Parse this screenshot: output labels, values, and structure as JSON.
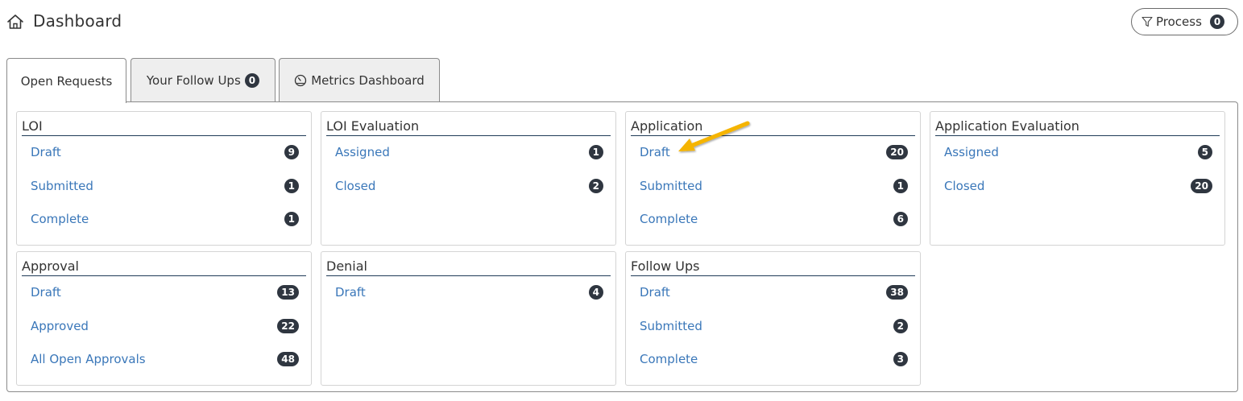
{
  "header": {
    "title": "Dashboard",
    "home_icon": "home-icon",
    "process_label": "Process",
    "process_count": "0"
  },
  "tabs": [
    {
      "label": "Open Requests",
      "active": true
    },
    {
      "label": "Your Follow Ups",
      "count": "0"
    },
    {
      "label": "Metrics Dashboard",
      "icon": "gauge-icon"
    }
  ],
  "cards": {
    "loi": {
      "title": "LOI",
      "rows": [
        {
          "label": "Draft",
          "count": "9"
        },
        {
          "label": "Submitted",
          "count": "1"
        },
        {
          "label": "Complete",
          "count": "1"
        }
      ]
    },
    "loi_evaluation": {
      "title": "LOI Evaluation",
      "rows": [
        {
          "label": "Assigned",
          "count": "1"
        },
        {
          "label": "Closed",
          "count": "2"
        }
      ]
    },
    "application": {
      "title": "Application",
      "rows": [
        {
          "label": "Draft",
          "count": "20"
        },
        {
          "label": "Submitted",
          "count": "1"
        },
        {
          "label": "Complete",
          "count": "6"
        }
      ]
    },
    "application_evaluation": {
      "title": "Application Evaluation",
      "rows": [
        {
          "label": "Assigned",
          "count": "5"
        },
        {
          "label": "Closed",
          "count": "20"
        }
      ]
    },
    "approval": {
      "title": "Approval",
      "rows": [
        {
          "label": "Draft",
          "count": "13"
        },
        {
          "label": "Approved",
          "count": "22"
        },
        {
          "label": "All Open Approvals",
          "count": "48"
        }
      ]
    },
    "denial": {
      "title": "Denial",
      "rows": [
        {
          "label": "Draft",
          "count": "4"
        }
      ]
    },
    "follow_ups": {
      "title": "Follow Ups",
      "rows": [
        {
          "label": "Draft",
          "count": "38"
        },
        {
          "label": "Submitted",
          "count": "2"
        },
        {
          "label": "Complete",
          "count": "3"
        }
      ]
    }
  },
  "colors": {
    "link": "#3a77b9",
    "badge_bg": "#2f3640",
    "annotation_arrow": "#f5b400"
  }
}
